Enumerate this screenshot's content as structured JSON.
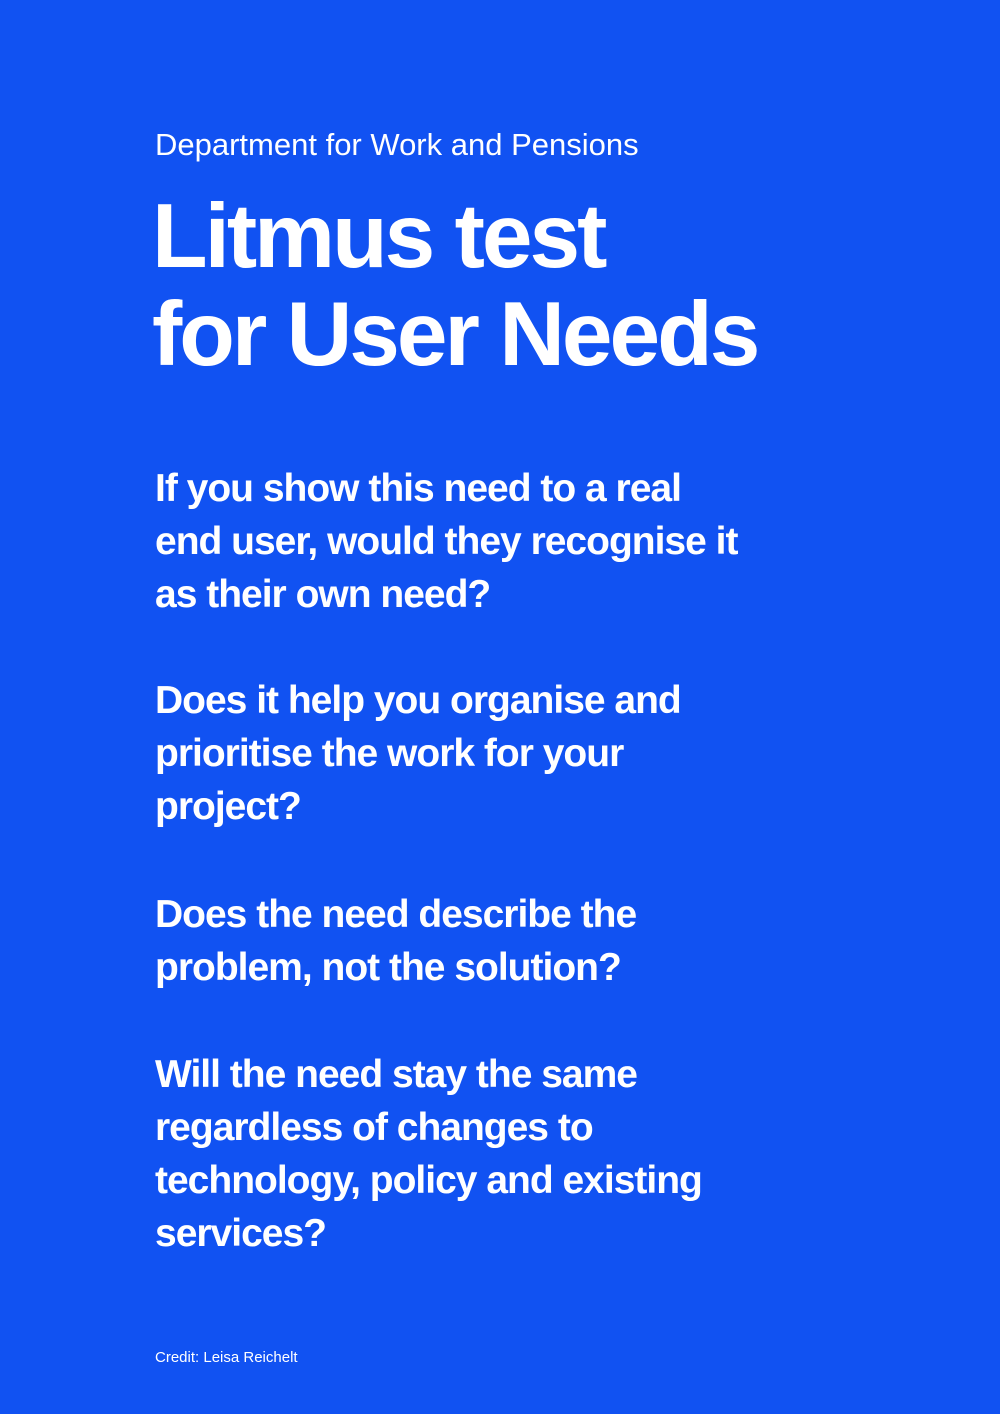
{
  "poster": {
    "background_color": "#1152f2",
    "text_color": "#ffffff",
    "department": "Department for Work and Pensions",
    "title_lines": [
      "Litmus test",
      "for User Needs"
    ],
    "questions": [
      {
        "lines": [
          "If you show this need to a real",
          "end user, would they recognise it",
          "as their own need?"
        ]
      },
      {
        "lines": [
          "Does it help you organise and",
          "prioritise the work for your",
          "project?"
        ]
      },
      {
        "lines": [
          "Does the need describe the",
          "problem, not the solution?"
        ]
      },
      {
        "lines": [
          "Will the need stay the same",
          "regardless of changes to",
          "technology, policy and existing",
          "services?"
        ]
      }
    ],
    "credit": "Credit: Leisa Reichelt"
  }
}
